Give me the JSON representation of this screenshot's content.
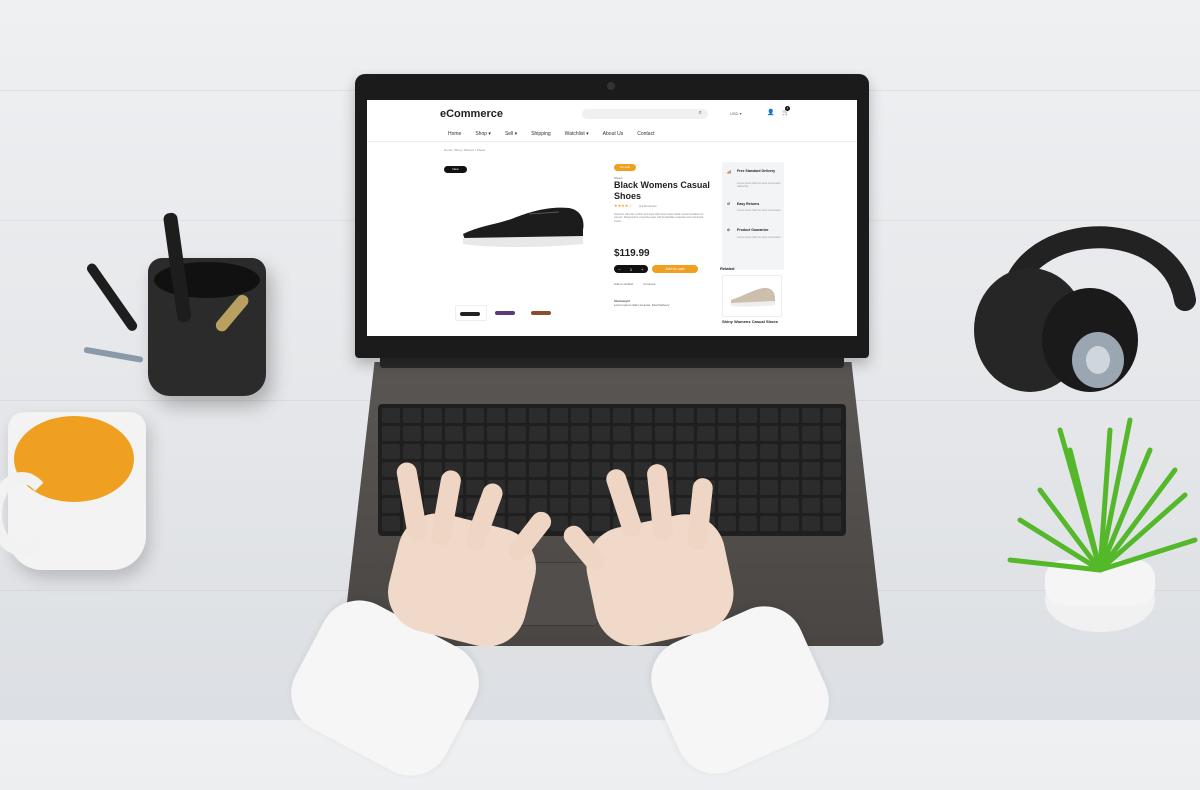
{
  "site": {
    "brand": "eCommerce",
    "currency": "USD",
    "cart_count": "1",
    "nav": [
      "Home",
      "Shop",
      "Sell",
      "Shipping",
      "Watchlist",
      "About Us",
      "Contact"
    ],
    "breadcrumb": "Home / Shop / Women / Shoes"
  },
  "product": {
    "new_badge": "New",
    "sale_badge": "On sale",
    "category": "Shoes",
    "title": "Black Womens Casual Shoes",
    "stars": "★★★★☆",
    "reviews": "(12 Reviews)",
    "description": "Discover ultimate comfort and style with these sleek black casual sneakers for women. Designed for everyday wear with breathable materials and cushioned insole.",
    "price": "$119.99",
    "qty_minus": "−",
    "qty_value": "1",
    "qty_plus": "+",
    "add_to_cart": "Add to cart",
    "wishlist": "Add to wishlist",
    "compare": "Compare",
    "sku_label": "Sku/weight",
    "sku_text": "Lorem ipsum dolor sit amet, Fast Delivery"
  },
  "sidebar": {
    "items": [
      {
        "title": "Free Standard Delivery",
        "sub": "Lorem ipsum dolor sit amet consectetur adipiscing"
      },
      {
        "title": "Easy Returns",
        "sub": "Lorem ipsum dolor sit amet consectetur"
      },
      {
        "title": "Product Guarantee",
        "sub": "Lorem ipsum dolor sit amet consectetur"
      }
    ]
  },
  "related": {
    "heading": "Related",
    "title": "Shiny Womens Casual Shoes"
  },
  "colors": {
    "accent": "#f0a020",
    "dark": "#111111"
  }
}
